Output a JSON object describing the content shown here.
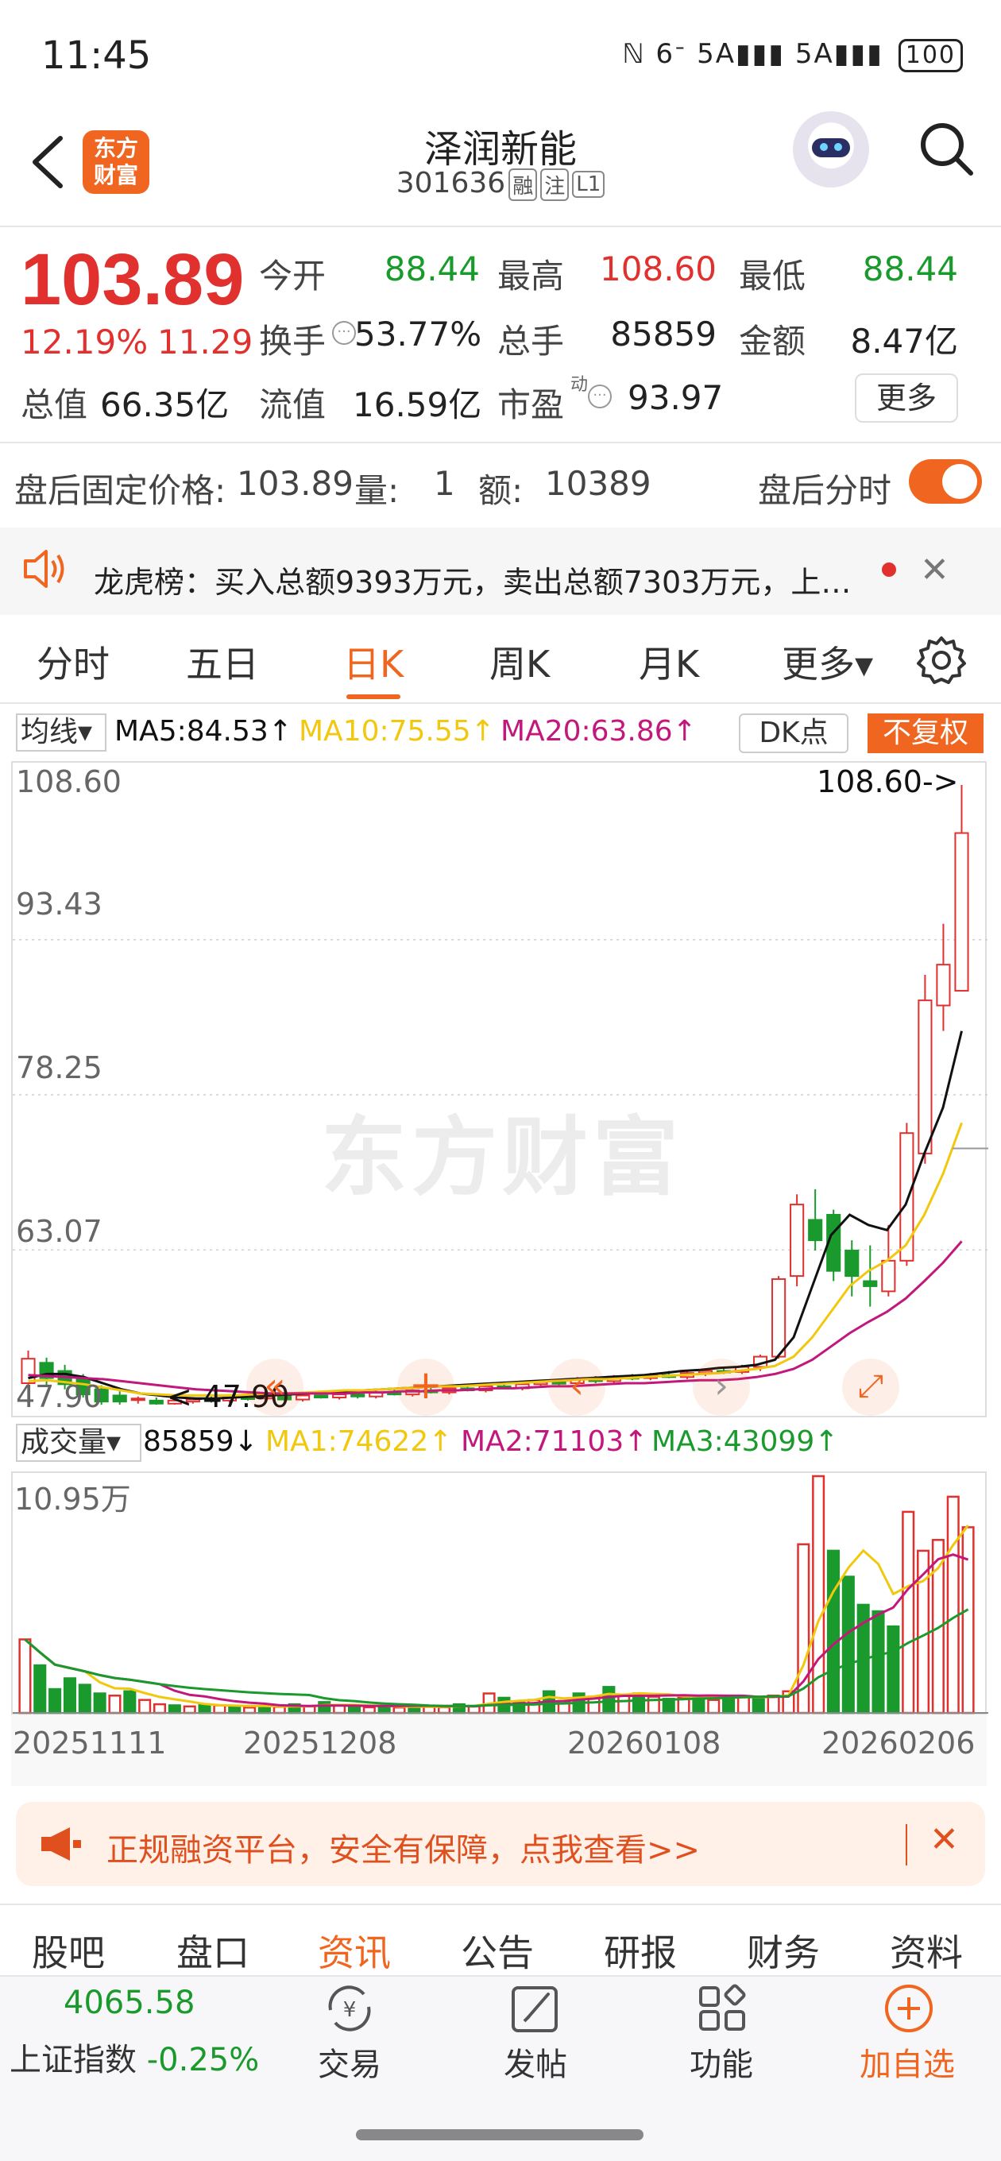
{
  "status_bar": {
    "time": "11:45",
    "icons": "ℕ 6ᐨ 5A▮▮▮ 5A▮▮▮",
    "battery": "100"
  },
  "header": {
    "logo_line1": "东方",
    "logo_line2": "财富",
    "stock_name": "泽润新能",
    "stock_code": "301636",
    "tags": [
      "融",
      "注",
      "L1"
    ]
  },
  "quote": {
    "price": "103.89",
    "change_pct": "12.19%",
    "change_amt": "11.29",
    "rows": [
      [
        {
          "label": "今开",
          "value": "88.44",
          "color": "green"
        },
        {
          "label": "最高",
          "value": "108.60",
          "color": "red"
        },
        {
          "label": "最低",
          "value": "88.44",
          "color": "green"
        }
      ],
      [
        {
          "label": "换手",
          "value": "53.77%",
          "color": "dark"
        },
        {
          "label": "总手",
          "value": "85859",
          "color": "dark"
        },
        {
          "label": "金额",
          "value": "8.47亿",
          "color": "dark"
        }
      ]
    ],
    "total_cap_label": "总值",
    "total_cap": "66.35亿",
    "float_cap_label": "流值",
    "float_cap": "16.59亿",
    "pe_label": "市盈",
    "pe_sup": "动",
    "pe": "93.97",
    "more_label": "更多"
  },
  "after_hours": {
    "price_label": "盘后固定价格:",
    "price": "103.89",
    "vol_label": "量:",
    "vol": "1",
    "amt_label": "额:",
    "amt": "10389",
    "toggle_label": "盘后分时",
    "toggle_on": true
  },
  "notice": {
    "text": "龙虎榜：买入总额9393万元，卖出总额7303万元，上…"
  },
  "chart_tabs": {
    "items": [
      "分时",
      "五日",
      "日K",
      "周K",
      "月K",
      "更多▾"
    ],
    "active": "日K"
  },
  "ma_legend": {
    "select": "均线▾",
    "ma5": "MA5:84.53↑",
    "ma10": "MA10:75.55↑",
    "ma20": "MA20:63.86↑",
    "dk_label": "DK点",
    "adjust_label": "不复权"
  },
  "colors": {
    "up": "#e0312e",
    "down": "#1a9a2c",
    "accent": "#f0651f",
    "ma5": "#111111",
    "ma10": "#f2c80f",
    "ma20": "#c2187b"
  },
  "chart_data": [
    {
      "type": "candlestick",
      "y_ticks": [
        "108.60",
        "93.43",
        "78.25",
        "63.07",
        "47.90"
      ],
      "ylim": [
        47.9,
        108.6
      ],
      "annotations": {
        "high_marker": "108.60->",
        "low_marker": "<-47.90"
      },
      "watermark": "东方财富",
      "series": [
        {
          "name": "MA5",
          "values": [
            50.5,
            50.9,
            50.9,
            50.6,
            50.0,
            49.4,
            49.0,
            48.8,
            48.6,
            48.5,
            48.5,
            48.6,
            48.7,
            48.8,
            48.9,
            49.0,
            49.1,
            49.2,
            49.3,
            49.4,
            49.5,
            49.6,
            49.7,
            49.8,
            49.9,
            50.0,
            50.1,
            50.2,
            50.3,
            50.4,
            50.5,
            50.6,
            50.7,
            50.8,
            51.0,
            51.2,
            51.3,
            51.5,
            51.6,
            51.8,
            52.3,
            54.5,
            59.5,
            64.5,
            66.5,
            65.5,
            65.0,
            67.5,
            72.5,
            77.0,
            84.5
          ]
        },
        {
          "name": "MA10",
          "values": [
            50.2,
            50.3,
            50.1,
            49.9,
            49.6,
            49.3,
            49.0,
            48.9,
            48.8,
            48.8,
            48.8,
            48.8,
            48.9,
            49.0,
            49.0,
            49.1,
            49.2,
            49.3,
            49.3,
            49.4,
            49.5,
            49.6,
            49.7,
            49.7,
            49.8,
            49.9,
            50.0,
            50.1,
            50.2,
            50.3,
            50.4,
            50.4,
            50.5,
            50.6,
            50.7,
            50.8,
            50.9,
            51.0,
            51.2,
            51.4,
            51.7,
            52.6,
            54.5,
            57.0,
            59.5,
            61.0,
            62.0,
            63.5,
            66.5,
            70.5,
            75.5
          ]
        },
        {
          "name": "MA20",
          "values": [
            50.8,
            50.7,
            50.6,
            50.5,
            50.4,
            50.2,
            50.0,
            49.8,
            49.6,
            49.4,
            49.3,
            49.2,
            49.1,
            49.0,
            49.0,
            49.0,
            49.0,
            49.0,
            49.1,
            49.1,
            49.2,
            49.2,
            49.3,
            49.3,
            49.4,
            49.5,
            49.5,
            49.6,
            49.7,
            49.7,
            49.8,
            49.9,
            50.0,
            50.0,
            50.1,
            50.2,
            50.3,
            50.3,
            50.4,
            50.6,
            50.9,
            51.4,
            52.3,
            53.6,
            54.9,
            56.0,
            57.0,
            58.3,
            60.0,
            61.8,
            63.9
          ]
        }
      ],
      "candles": [
        {
          "o": 50.0,
          "h": 53.2,
          "l": 49.6,
          "c": 52.4
        },
        {
          "o": 52.0,
          "h": 52.5,
          "l": 49.8,
          "c": 50.5
        },
        {
          "o": 51.2,
          "h": 51.8,
          "l": 49.4,
          "c": 49.9
        },
        {
          "o": 50.5,
          "h": 50.9,
          "l": 48.6,
          "c": 48.9
        },
        {
          "o": 49.4,
          "h": 49.8,
          "l": 47.9,
          "c": 48.2
        },
        {
          "o": 48.8,
          "h": 49.2,
          "l": 47.9,
          "c": 48.2
        },
        {
          "o": 48.4,
          "h": 48.7,
          "l": 48.0,
          "c": 48.5
        },
        {
          "o": 48.3,
          "h": 48.6,
          "l": 47.9,
          "c": 48.0
        },
        {
          "o": 48.0,
          "h": 48.4,
          "l": 47.9,
          "c": 48.3
        },
        {
          "o": 48.2,
          "h": 48.6,
          "l": 48.0,
          "c": 48.4
        },
        {
          "o": 48.4,
          "h": 48.7,
          "l": 48.1,
          "c": 48.3
        },
        {
          "o": 48.3,
          "h": 48.8,
          "l": 48.1,
          "c": 48.6
        },
        {
          "o": 48.6,
          "h": 48.9,
          "l": 48.3,
          "c": 48.5
        },
        {
          "o": 48.5,
          "h": 48.9,
          "l": 48.3,
          "c": 48.7
        },
        {
          "o": 48.8,
          "h": 49.0,
          "l": 48.3,
          "c": 48.4
        },
        {
          "o": 48.4,
          "h": 48.9,
          "l": 48.2,
          "c": 48.8
        },
        {
          "o": 48.8,
          "h": 49.1,
          "l": 48.5,
          "c": 48.6
        },
        {
          "o": 48.6,
          "h": 49.0,
          "l": 48.4,
          "c": 48.9
        },
        {
          "o": 48.9,
          "h": 49.2,
          "l": 48.5,
          "c": 48.7
        },
        {
          "o": 48.7,
          "h": 49.3,
          "l": 48.5,
          "c": 49.1
        },
        {
          "o": 49.1,
          "h": 49.5,
          "l": 48.8,
          "c": 48.9
        },
        {
          "o": 48.9,
          "h": 49.4,
          "l": 48.7,
          "c": 49.3
        },
        {
          "o": 49.3,
          "h": 49.6,
          "l": 49.0,
          "c": 49.1
        },
        {
          "o": 49.1,
          "h": 49.6,
          "l": 48.9,
          "c": 49.5
        },
        {
          "o": 49.5,
          "h": 49.8,
          "l": 49.2,
          "c": 49.3
        },
        {
          "o": 49.3,
          "h": 49.9,
          "l": 49.1,
          "c": 49.7
        },
        {
          "o": 49.7,
          "h": 50.0,
          "l": 49.4,
          "c": 49.5
        },
        {
          "o": 49.5,
          "h": 50.1,
          "l": 49.3,
          "c": 49.9
        },
        {
          "o": 49.9,
          "h": 50.3,
          "l": 49.6,
          "c": 50.1
        },
        {
          "o": 50.1,
          "h": 50.4,
          "l": 49.8,
          "c": 50.0
        },
        {
          "o": 50.0,
          "h": 50.6,
          "l": 49.8,
          "c": 50.4
        },
        {
          "o": 50.4,
          "h": 50.7,
          "l": 50.0,
          "c": 50.2
        },
        {
          "o": 50.2,
          "h": 50.8,
          "l": 50.0,
          "c": 50.6
        },
        {
          "o": 50.6,
          "h": 50.9,
          "l": 50.3,
          "c": 50.5
        },
        {
          "o": 50.5,
          "h": 51.0,
          "l": 50.3,
          "c": 50.8
        },
        {
          "o": 50.8,
          "h": 51.2,
          "l": 50.5,
          "c": 50.6
        },
        {
          "o": 50.6,
          "h": 51.3,
          "l": 50.4,
          "c": 51.0
        },
        {
          "o": 51.0,
          "h": 51.4,
          "l": 50.7,
          "c": 51.2
        },
        {
          "o": 51.2,
          "h": 51.6,
          "l": 50.9,
          "c": 51.1
        },
        {
          "o": 51.1,
          "h": 51.8,
          "l": 50.9,
          "c": 51.6
        },
        {
          "o": 51.6,
          "h": 52.8,
          "l": 51.2,
          "c": 52.6
        },
        {
          "o": 52.6,
          "h": 60.5,
          "l": 52.4,
          "c": 60.2
        },
        {
          "o": 60.5,
          "h": 68.5,
          "l": 59.5,
          "c": 67.5
        },
        {
          "o": 66.0,
          "h": 69.0,
          "l": 63.0,
          "c": 64.0
        },
        {
          "o": 66.5,
          "h": 67.0,
          "l": 60.0,
          "c": 61.0
        },
        {
          "o": 63.0,
          "h": 64.0,
          "l": 58.5,
          "c": 60.5
        },
        {
          "o": 60.0,
          "h": 63.5,
          "l": 57.5,
          "c": 59.5
        },
        {
          "o": 59.0,
          "h": 65.5,
          "l": 58.5,
          "c": 62.0
        },
        {
          "o": 62.0,
          "h": 75.5,
          "l": 61.5,
          "c": 74.5
        },
        {
          "o": 72.5,
          "h": 90.0,
          "l": 71.5,
          "c": 87.5
        },
        {
          "o": 87.0,
          "h": 95.0,
          "l": 84.5,
          "c": 91.0
        },
        {
          "o": 88.44,
          "h": 108.6,
          "l": 88.44,
          "c": 103.89
        }
      ]
    },
    {
      "type": "bar",
      "title": "成交量",
      "y_ticks": [
        "10.95万"
      ],
      "ylim": [
        0,
        109500
      ],
      "x_ticks": [
        "20251111",
        "20251208",
        "20260108",
        "20260206"
      ],
      "legend": {
        "select": "成交量▾",
        "vol": "85859↓",
        "ma1": "MA1:74622↑",
        "ma2": "MA2:71103↑",
        "ma3": "MA3:43099↑"
      },
      "values": [
        34000,
        22000,
        11000,
        16000,
        13000,
        9000,
        8000,
        10000,
        6000,
        4000,
        3500,
        3000,
        4000,
        3500,
        3000,
        2500,
        3000,
        2800,
        4000,
        3000,
        5000,
        3500,
        3000,
        2600,
        3000,
        2500,
        3500,
        2800,
        2600,
        4000,
        3000,
        9000,
        7000,
        5000,
        6000,
        10000,
        5500,
        9000,
        7500,
        12000,
        8000,
        9000,
        7500,
        6500,
        7000,
        8000,
        6000,
        8000,
        7500,
        7000,
        8000,
        10000,
        78000,
        109500,
        75000,
        63000,
        50000,
        47000,
        40000,
        93000,
        75000,
        80000,
        100000,
        85859
      ],
      "up": [
        true,
        false,
        false,
        false,
        false,
        false,
        true,
        false,
        true,
        true,
        false,
        true,
        false,
        true,
        false,
        true,
        false,
        true,
        false,
        true,
        false,
        true,
        false,
        true,
        false,
        true,
        false,
        true,
        true,
        false,
        true,
        true,
        false,
        false,
        true,
        false,
        true,
        false,
        true,
        false,
        true,
        false,
        true,
        false,
        true,
        false,
        true,
        false,
        true,
        false,
        true,
        true,
        true,
        true,
        false,
        false,
        false,
        false,
        false,
        true,
        true,
        true,
        true,
        true
      ]
    }
  ],
  "promo": {
    "text": "正规融资平台，安全有保障，点我查看>>"
  },
  "bottom_tabs": {
    "items": [
      "股吧",
      "盘口",
      "资讯",
      "公告",
      "研报",
      "财务",
      "资料"
    ],
    "active": "资讯"
  },
  "bottom_bar": {
    "index_value": "4065.58",
    "index_name": "上证指数",
    "index_change": "-0.25%",
    "nav": [
      {
        "label": "交易",
        "icon": "trade-icon"
      },
      {
        "label": "发帖",
        "icon": "post-icon"
      },
      {
        "label": "功能",
        "icon": "apps-icon"
      },
      {
        "label": "加自选",
        "icon": "add-favorite-icon"
      }
    ]
  }
}
